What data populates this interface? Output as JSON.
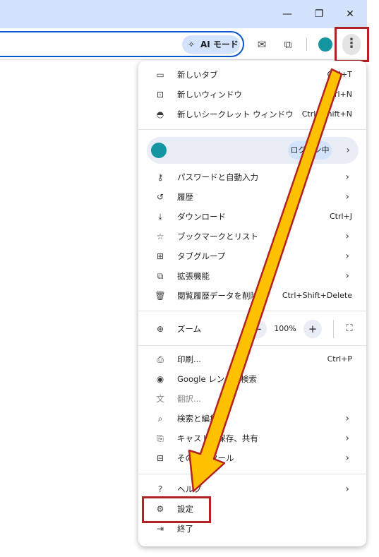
{
  "window_controls": {
    "minimize_icon": "minimize-icon",
    "restore_icon": "restore-icon",
    "close_icon": "close-icon",
    "minimize_glyph": "—",
    "restore_glyph": "❐",
    "close_glyph": "✕"
  },
  "toolbar": {
    "ai_mode_label": "AI モード",
    "mail_glyph": "✉",
    "extensions_glyph": "⧉",
    "menu_glyph": "⋮"
  },
  "menu": {
    "new_tab": {
      "label": "新しいタブ",
      "shortcut": "Ctrl+T"
    },
    "new_window": {
      "label": "新しいウィンドウ",
      "shortcut": "Ctrl+N"
    },
    "new_incognito": {
      "label": "新しいシークレット ウィンドウ",
      "shortcut": "Ctrl+Shift+N"
    },
    "profile": {
      "status": "ログイン中"
    },
    "passwords": {
      "label": "パスワードと自動入力"
    },
    "history": {
      "label": "履歴"
    },
    "downloads": {
      "label": "ダウンロード",
      "shortcut": "Ctrl+J"
    },
    "bookmarks": {
      "label": "ブックマークとリスト"
    },
    "tab_groups": {
      "label": "タブグループ"
    },
    "extensions": {
      "label": "拡張機能"
    },
    "clear_data": {
      "label": "閲覧履歴データを削除",
      "shortcut": "Ctrl+Shift+Delete"
    },
    "zoom": {
      "label": "ズーム",
      "value": "100%",
      "minus": "−",
      "plus": "+"
    },
    "print": {
      "label": "印刷...",
      "shortcut": "Ctrl+P"
    },
    "lens": {
      "label": "Google レンズで検索"
    },
    "translate": {
      "label": "翻訳..."
    },
    "find_edit": {
      "label": "検索と編集"
    },
    "cast_save": {
      "label": "キャスト、保存、共有"
    },
    "more_tools": {
      "label": "その他のツール"
    },
    "help": {
      "label": "ヘルプ"
    },
    "settings": {
      "label": "設定"
    },
    "exit": {
      "label": "終了"
    },
    "chevron": "›"
  },
  "colors": {
    "titlebar": "#d3e3fd",
    "accent_blue": "#0b57d0",
    "avatar": "#13969f",
    "highlight_red": "#b22222",
    "arrow_fill": "#ffc000"
  }
}
